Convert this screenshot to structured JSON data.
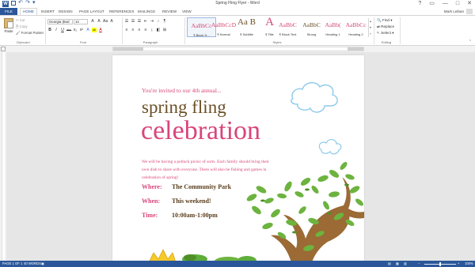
{
  "window": {
    "title": "Spring Fling Flyer - Word",
    "controls": [
      "?",
      "▭",
      "—",
      "□",
      "✕"
    ]
  },
  "qat": {
    "word_icon": "W",
    "icons": [
      "save-icon",
      "undo-icon",
      "redo-icon",
      "qat-more-icon"
    ]
  },
  "tabs": [
    "FILE",
    "HOME",
    "INSERT",
    "DESIGN",
    "PAGE LAYOUT",
    "REFERENCES",
    "MAILINGS",
    "REVIEW",
    "VIEW"
  ],
  "active_tab": "HOME",
  "user": {
    "name": "Mark Leiban"
  },
  "ribbon": {
    "clipboard": {
      "paste": "Paste",
      "cut": "Cut",
      "copy": "Copy",
      "format_painter": "Format Painter",
      "label": "Clipboard"
    },
    "font": {
      "family": "Georgia (Bod",
      "size": "14",
      "row1": [
        "A",
        "A",
        "Aa",
        "A"
      ],
      "row2": [
        "B",
        "I",
        "U",
        "abc",
        "x₂",
        "x²",
        "A",
        "ab",
        "A"
      ],
      "label": "Font"
    },
    "paragraph": {
      "row1": [
        "☰",
        "☰",
        "☰",
        "⇤",
        "⇥",
        "↕",
        "¶"
      ],
      "row2": [
        "≡",
        "≡",
        "≡",
        "≡",
        "↨",
        "◧",
        "⊞"
      ],
      "label": "Paragraph"
    },
    "styles": {
      "items": [
        {
          "sample": "AaBbCc",
          "name": "¶ Block H...",
          "selected": true
        },
        {
          "sample": "AaBbCcD",
          "name": "¶ Normal",
          "selected": false
        },
        {
          "sample": "Aa B",
          "name": "¶ Subtitle",
          "selected": false
        },
        {
          "sample": "A",
          "name": "¶ Title",
          "selected": false
        },
        {
          "sample": "AaBbC",
          "name": "¶ Block Text",
          "selected": false
        },
        {
          "sample": "AaBbC",
          "name": "Strong",
          "selected": false
        },
        {
          "sample": "AaBb(",
          "name": "Heading 1",
          "selected": false
        },
        {
          "sample": "AaBbCc",
          "name": "Heading 2",
          "selected": false
        }
      ],
      "label": "Styles"
    },
    "editing": {
      "find": "Find",
      "replace": "Replace",
      "select": "Select",
      "label": "Editing"
    }
  },
  "document": {
    "invite": "You're invited to our 4th annual...",
    "title_line1": "spring fling",
    "title_line2": "celebration",
    "body": "We will be having a potluck picnic of sorts. Each family should bring their own dish to share with everyone. There will also be fishing and games in celebration of spring!",
    "details": [
      {
        "label": "Where:",
        "value": "The Community Park"
      },
      {
        "label": "When:",
        "value": "This weekend!"
      },
      {
        "label": "Time:",
        "value": "10:00am-1:00pm"
      }
    ]
  },
  "status": {
    "page": "PAGE 1 OF 1",
    "words": "40 WORDS",
    "zoom": "100%",
    "zoom_fraction": 0.5
  },
  "colors": {
    "accent": "#2b579a",
    "pink": "#d9457a",
    "brown": "#6b5026",
    "tree_trunk": "#9b6a35",
    "leaf": "#6db33f",
    "cloud": "#8ec9ea"
  }
}
